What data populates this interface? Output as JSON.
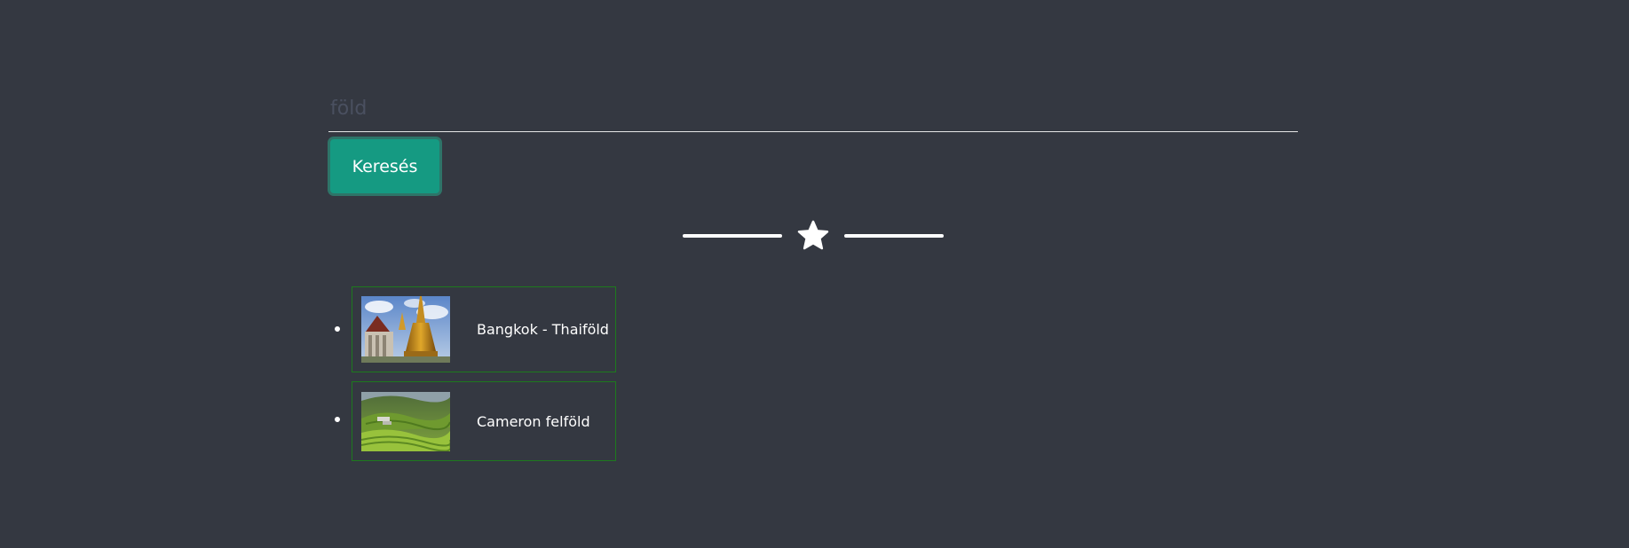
{
  "search": {
    "placeholder": "föld",
    "button_label": "Keresés"
  },
  "divider": {
    "icon": "star-icon"
  },
  "results": [
    {
      "label": "Bangkok - Thaiföld",
      "image": "temple-photo"
    },
    {
      "label": "Cameron felföld",
      "image": "tea-plantation-photo"
    }
  ],
  "colors": {
    "background": "#343841",
    "accent": "#159a82",
    "card_border": "#1d7a1d"
  }
}
